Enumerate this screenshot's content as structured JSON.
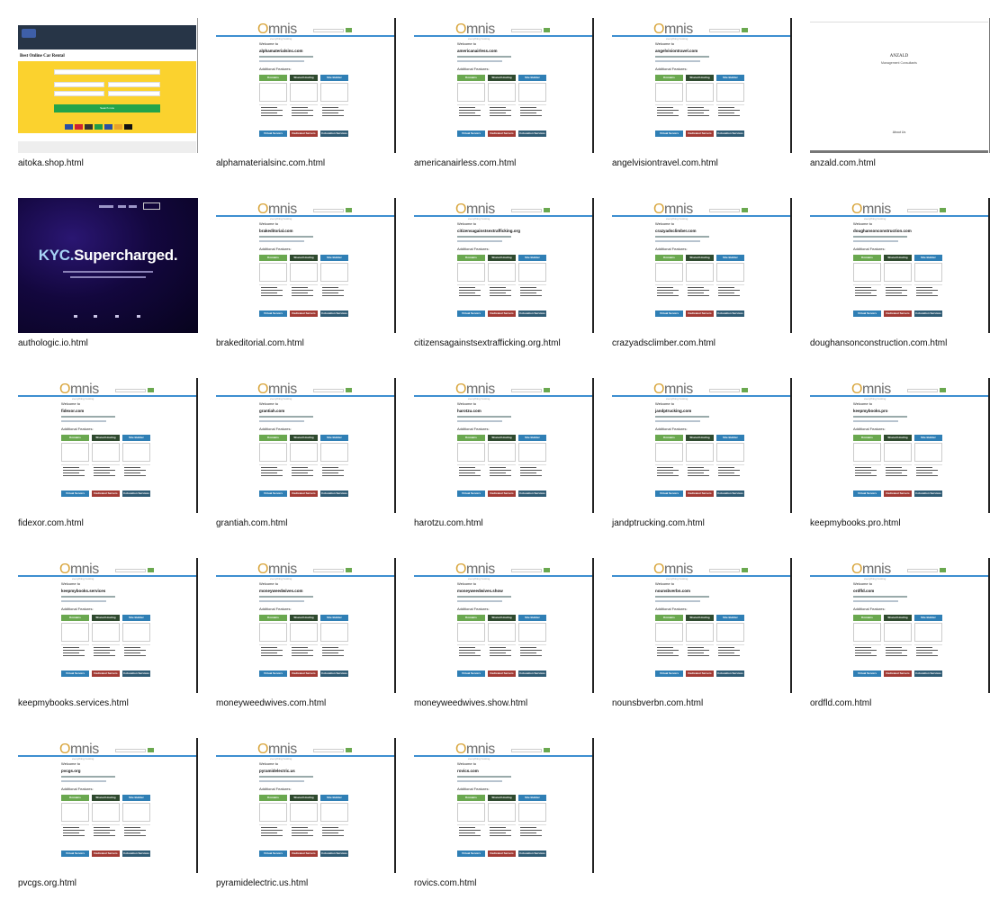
{
  "omnis": {
    "logo_prefix": "O",
    "logo_rest": "mnis",
    "tagline": "everything hosting",
    "welcome": "Welcome to",
    "features_title": "Additional Features:",
    "buttons": [
      {
        "label": "Domains",
        "color": "#6aa84f"
      },
      {
        "label": "Shared Hosting",
        "color": "#2e4a2e"
      },
      {
        "label": "Site Builder",
        "color": "#2f7fb5"
      },
      {
        "label": "Virtual Servers",
        "color": "#2f7fb5"
      },
      {
        "label": "Dedicated Servers",
        "color": "#a23a34"
      },
      {
        "label": "Colocation Services",
        "color": "#2e5b74"
      }
    ]
  },
  "thumbnails": [
    {
      "filename": "aitoka.shop.html",
      "kind": "aitoka"
    },
    {
      "filename": "alphamaterialsinc.com.html",
      "kind": "omnis",
      "domain": "alphamaterialsinc.com"
    },
    {
      "filename": "americanairless.com.html",
      "kind": "omnis",
      "domain": "americanairless.com"
    },
    {
      "filename": "angelvisiontravel.com.html",
      "kind": "omnis",
      "domain": "angelvisiontravel.com"
    },
    {
      "filename": "anzald.com.html",
      "kind": "anzald"
    },
    {
      "filename": "authologic.io.html",
      "kind": "authologic"
    },
    {
      "filename": "brakeditorial.com.html",
      "kind": "omnis",
      "domain": "brakeditorial.com"
    },
    {
      "filename": "citizensagainstsextrafficking.org.html",
      "kind": "omnis",
      "domain": "citizensagainstsextrafficking.org"
    },
    {
      "filename": "crazyadsclimber.com.html",
      "kind": "omnis",
      "domain": "crazyadsclimber.com"
    },
    {
      "filename": "doughansonconstruction.com.html",
      "kind": "omnis",
      "domain": "doughansonconstruction.com"
    },
    {
      "filename": "fidexor.com.html",
      "kind": "omnis",
      "domain": "fidexor.com"
    },
    {
      "filename": "grantiah.com.html",
      "kind": "omnis",
      "domain": "grantiah.com"
    },
    {
      "filename": "harotzu.com.html",
      "kind": "omnis",
      "domain": "harotzu.com"
    },
    {
      "filename": "jandptrucking.com.html",
      "kind": "omnis",
      "domain": "jandptrucking.com"
    },
    {
      "filename": "keepmybooks.pro.html",
      "kind": "omnis",
      "domain": "keepmybooks.pro"
    },
    {
      "filename": "keepmybooks.services.html",
      "kind": "omnis",
      "domain": "keepmybooks.services"
    },
    {
      "filename": "moneyweedwives.com.html",
      "kind": "omnis",
      "domain": "moneyweedwives.com"
    },
    {
      "filename": "moneyweedwives.show.html",
      "kind": "omnis",
      "domain": "moneyweedwives.show"
    },
    {
      "filename": "nounsbverbn.com.html",
      "kind": "omnis",
      "domain": "nounsbverbn.com"
    },
    {
      "filename": "ordfld.com.html",
      "kind": "omnis",
      "domain": "ordfld.com"
    },
    {
      "filename": "pvcgs.org.html",
      "kind": "omnis",
      "domain": "pvcgs.org"
    },
    {
      "filename": "pyramidelectric.us.html",
      "kind": "omnis",
      "domain": "pyramidelectric.us"
    },
    {
      "filename": "rovics.com.html",
      "kind": "omnis",
      "domain": "rovics.com"
    }
  ],
  "aitoka": {
    "title": "Best Online Car Rental",
    "search_button": "Search now"
  },
  "anzald": {
    "name": "ANZALD",
    "subtitle": "Management Consultants",
    "about": "About Us"
  },
  "authologic": {
    "hero_part1": "KYC.",
    "hero_part2": "Supercharged."
  }
}
